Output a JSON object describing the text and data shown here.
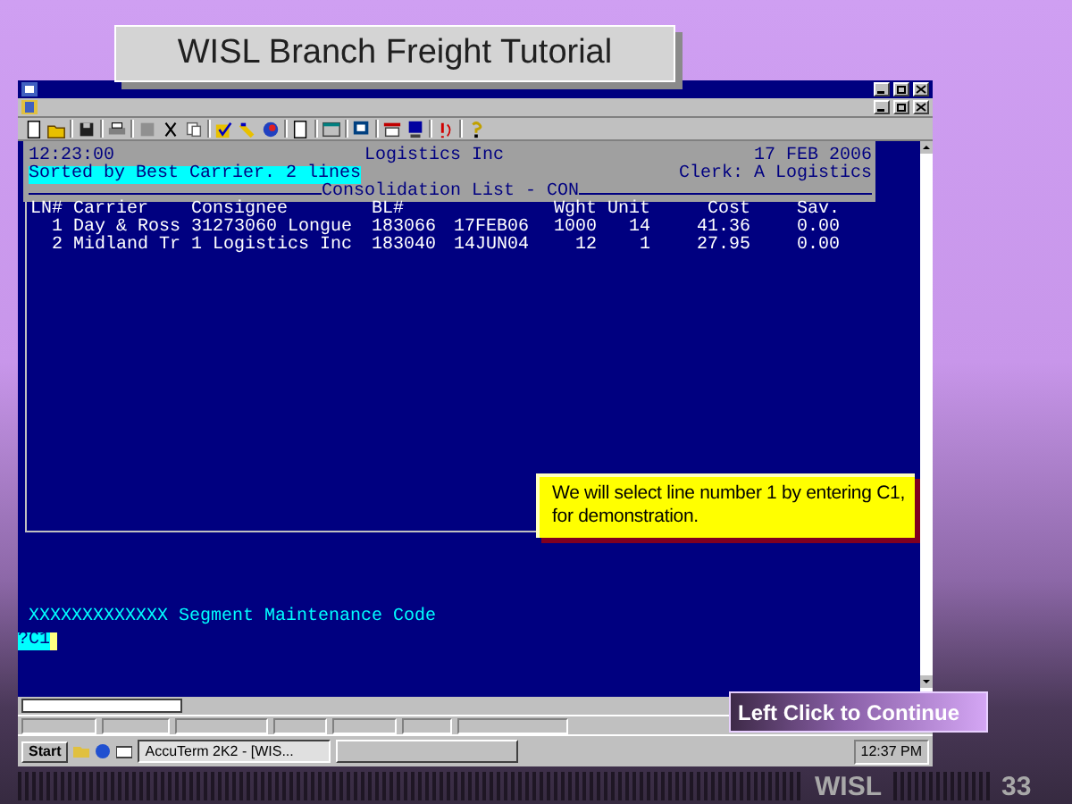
{
  "slide_title": "WISL Branch Freight Tutorial",
  "terminal": {
    "time": "12:23:00",
    "company": "Logistics Inc",
    "date": "17 FEB 2006",
    "sort_note": "Sorted by Best Carrier. 2 lines",
    "clerk": "Clerk: A Logistics",
    "list_title": "Consolidation List - CON",
    "columns": [
      "LN#",
      "Carrier",
      "Consignee",
      "BL#",
      "Wght",
      "Unit",
      "Cost",
      "Sav."
    ],
    "rows": [
      {
        "ln": "1",
        "carrier": "Day & Ross",
        "consignee": "31273060 Longue",
        "bl": "183066",
        "column_5": "17FEB06",
        "wght": "1000",
        "unit": "14",
        "cost": "41.36",
        "sav": "0.00"
      },
      {
        "ln": "2",
        "carrier": "Midland Tr",
        "consignee": "1 Logistics Inc",
        "bl": "183040",
        "column_5": "14JUN04",
        "wght": "12",
        "unit": "1",
        "cost": "27.95",
        "sav": "0.00"
      }
    ],
    "prompt_label": "XXXXXXXXXXXXX Segment Maintenance Code",
    "command": "?C1"
  },
  "callout": "We will select line number 1 by entering C1, for demonstration.",
  "taskbar": {
    "start": "Start",
    "tasks": [
      {
        "label": "AccuTerm 2K2 - [WIS...",
        "selected": true
      }
    ],
    "clock": "12:37 PM"
  },
  "continue_button": "Left Click to Continue",
  "footer": {
    "brand": "WISL",
    "page": "33"
  }
}
